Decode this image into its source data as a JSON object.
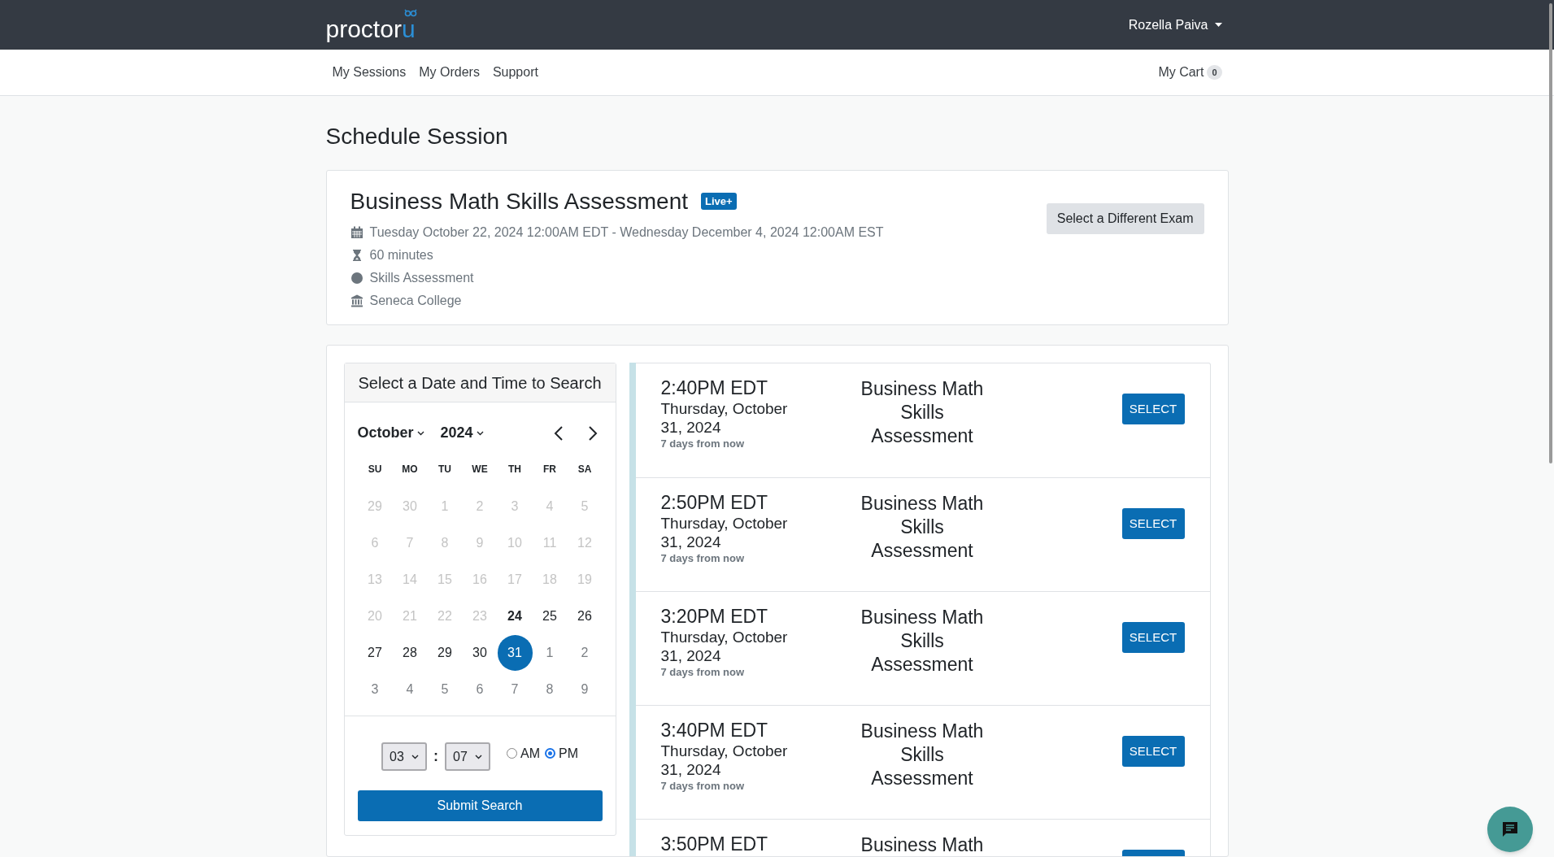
{
  "logo": {
    "text": "proctor",
    "accent": "u"
  },
  "user_menu": {
    "label": "Rozella Paiva"
  },
  "nav": {
    "links": [
      {
        "label": "My Sessions"
      },
      {
        "label": "My Orders"
      },
      {
        "label": "Support"
      }
    ],
    "cart": {
      "label": "My Cart",
      "count": "0"
    }
  },
  "page_title": "Schedule Session",
  "exam": {
    "title": "Business Math Skills Assessment",
    "badge": "Live+",
    "button": "Select a Different Exam",
    "details": [
      {
        "kind": "calendar",
        "text": "Tuesday October 22, 2024 12:00AM EDT - Wednesday December 4, 2024 12:00AM EST"
      },
      {
        "kind": "duration",
        "text": "60 minutes"
      },
      {
        "kind": "type",
        "text": "Skills Assessment"
      },
      {
        "kind": "institution",
        "text": "Seneca College"
      }
    ]
  },
  "search": {
    "title": "Select a Date and Time to Search",
    "month": "October",
    "year": "2024",
    "weekdays": [
      "SU",
      "MO",
      "TU",
      "WE",
      "TH",
      "FR",
      "SA"
    ],
    "days": [
      {
        "label": "29",
        "kind": "disabled",
        "selected": false
      },
      {
        "label": "30",
        "kind": "disabled",
        "selected": false
      },
      {
        "label": "1",
        "kind": "disabled",
        "selected": false
      },
      {
        "label": "2",
        "kind": "disabled",
        "selected": false
      },
      {
        "label": "3",
        "kind": "disabled",
        "selected": false
      },
      {
        "label": "4",
        "kind": "disabled",
        "selected": false
      },
      {
        "label": "5",
        "kind": "disabled",
        "selected": false
      },
      {
        "label": "6",
        "kind": "disabled",
        "selected": false
      },
      {
        "label": "7",
        "kind": "disabled",
        "selected": false
      },
      {
        "label": "8",
        "kind": "disabled",
        "selected": false
      },
      {
        "label": "9",
        "kind": "disabled",
        "selected": false
      },
      {
        "label": "10",
        "kind": "disabled",
        "selected": false
      },
      {
        "label": "11",
        "kind": "disabled",
        "selected": false
      },
      {
        "label": "12",
        "kind": "disabled",
        "selected": false
      },
      {
        "label": "13",
        "kind": "disabled",
        "selected": false
      },
      {
        "label": "14",
        "kind": "disabled",
        "selected": false
      },
      {
        "label": "15",
        "kind": "disabled",
        "selected": false
      },
      {
        "label": "16",
        "kind": "disabled",
        "selected": false
      },
      {
        "label": "17",
        "kind": "disabled",
        "selected": false
      },
      {
        "label": "18",
        "kind": "disabled",
        "selected": false
      },
      {
        "label": "19",
        "kind": "disabled",
        "selected": false
      },
      {
        "label": "20",
        "kind": "disabled",
        "selected": false
      },
      {
        "label": "21",
        "kind": "disabled",
        "selected": false
      },
      {
        "label": "22",
        "kind": "disabled",
        "selected": false
      },
      {
        "label": "23",
        "kind": "disabled",
        "selected": false
      },
      {
        "label": "24",
        "kind": "today",
        "selected": false
      },
      {
        "label": "25",
        "kind": "available",
        "selected": false
      },
      {
        "label": "26",
        "kind": "available",
        "selected": false
      },
      {
        "label": "27",
        "kind": "available",
        "selected": false
      },
      {
        "label": "28",
        "kind": "available",
        "selected": false
      },
      {
        "label": "29",
        "kind": "available",
        "selected": false
      },
      {
        "label": "30",
        "kind": "available",
        "selected": false
      },
      {
        "label": "31",
        "kind": "available",
        "selected": true
      },
      {
        "label": "1",
        "kind": "outside",
        "selected": false
      },
      {
        "label": "2",
        "kind": "outside",
        "selected": false
      },
      {
        "label": "3",
        "kind": "outside",
        "selected": false
      },
      {
        "label": "4",
        "kind": "outside",
        "selected": false
      },
      {
        "label": "5",
        "kind": "outside",
        "selected": false
      },
      {
        "label": "6",
        "kind": "outside",
        "selected": false
      },
      {
        "label": "7",
        "kind": "outside",
        "selected": false
      },
      {
        "label": "8",
        "kind": "outside",
        "selected": false
      },
      {
        "label": "9",
        "kind": "outside",
        "selected": false
      }
    ],
    "hour": {
      "value": "03"
    },
    "separator": ":",
    "minute": {
      "value": "07"
    },
    "meridiem": [
      {
        "label": "AM",
        "selected": false
      },
      {
        "label": "PM",
        "selected": true
      }
    ],
    "submit": "Submit Search"
  },
  "results": [
    {
      "time": "2:40PM EDT",
      "date": "Thursday, October 31, 2024",
      "relative": "7 days from now",
      "exam": "Business Math Skills Assessment",
      "button": "SELECT"
    },
    {
      "time": "2:50PM EDT",
      "date": "Thursday, October 31, 2024",
      "relative": "7 days from now",
      "exam": "Business Math Skills Assessment",
      "button": "SELECT"
    },
    {
      "time": "3:20PM EDT",
      "date": "Thursday, October 31, 2024",
      "relative": "7 days from now",
      "exam": "Business Math Skills Assessment",
      "button": "SELECT"
    },
    {
      "time": "3:40PM EDT",
      "date": "Thursday, October 31, 2024",
      "relative": "7 days from now",
      "exam": "Business Math Skills Assessment",
      "button": "SELECT"
    },
    {
      "time": "3:50PM EDT",
      "exam": "Business Math"
    }
  ]
}
